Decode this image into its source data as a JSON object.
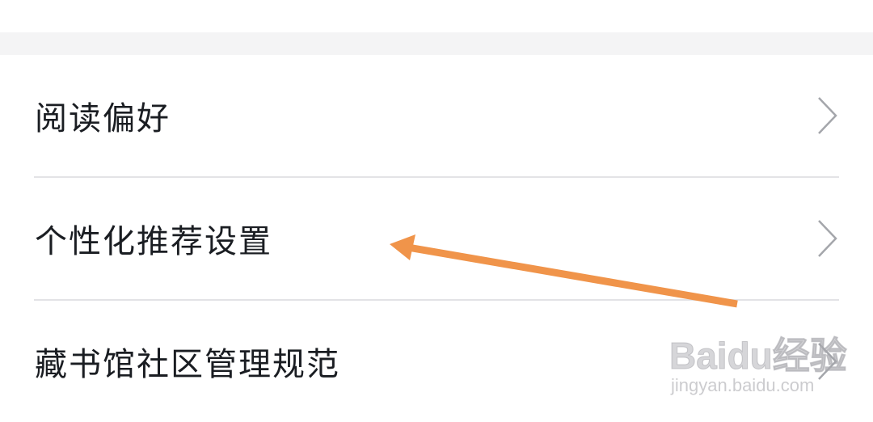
{
  "settings_list": {
    "items": [
      {
        "label": "阅读偏好",
        "icon": "chevron-right-icon"
      },
      {
        "label": "个性化推荐设置",
        "icon": "chevron-right-icon"
      },
      {
        "label": "藏书馆社区管理规范",
        "icon": "chevron-right-icon"
      }
    ]
  },
  "annotation": {
    "color": "#f0944a",
    "icon": "arrow-left-icon"
  },
  "watermark": {
    "brand": "Baidu经验",
    "url": "jingyan.baidu.com"
  }
}
